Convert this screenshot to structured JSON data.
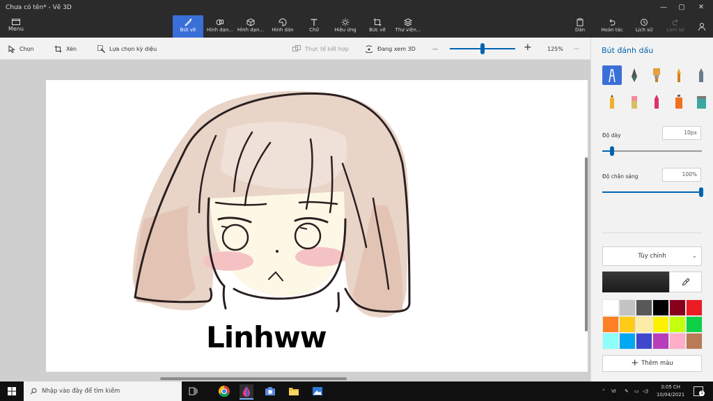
{
  "window": {
    "title": "Chưa có tên* - Vẽ 3D",
    "min": "—",
    "max": "▢",
    "close": "✕"
  },
  "ribbon": {
    "menu": "Menu",
    "tabs": [
      {
        "label": "Bút vẽ"
      },
      {
        "label": "Hình dạn..."
      },
      {
        "label": "Hình dạn..."
      },
      {
        "label": "Hình dán"
      },
      {
        "label": "Chữ"
      },
      {
        "label": "Hiệu ứng"
      },
      {
        "label": "Bức vẽ"
      },
      {
        "label": "Thư viện..."
      }
    ],
    "right": [
      {
        "label": "Dán"
      },
      {
        "label": "Hoàn tác"
      },
      {
        "label": "Lịch sử"
      },
      {
        "label": "Làm lại"
      }
    ]
  },
  "toolbar": {
    "select": "Chọn",
    "crop": "Xén",
    "magic": "Lựa chọn kỳ diệu",
    "mixed_reality": "Thực tế kết hợp",
    "view3d": "Đang xem 3D",
    "zoom_minus": "—",
    "zoom_plus": "+",
    "zoom_value": "125%",
    "zoom_fraction": 0.5,
    "more": "···"
  },
  "canvas": {
    "signature": "Linhww"
  },
  "panel": {
    "title": "Bút đánh dấu",
    "thickness_label": "Độ dày",
    "thickness_value": "10px",
    "thickness_fraction": 0.1,
    "opacity_label": "Độ chắn sáng",
    "opacity_value": "100%",
    "opacity_fraction": 1.0,
    "custom": "Tùy chỉnh",
    "add_color": "Thêm màu",
    "palette": [
      "#ffffff",
      "#c3c3c3",
      "#585858",
      "#000000",
      "#88001b",
      "#ec1c24",
      "#ff7f27",
      "#ffca18",
      "#fdeca6",
      "#fff200",
      "#c4ff0e",
      "#0ed145",
      "#8cfffb",
      "#00a8f3",
      "#3f48cc",
      "#b83dba",
      "#ffaec8",
      "#b97a56"
    ],
    "current_color": "#222222"
  },
  "taskbar": {
    "search_placeholder": "Nhập vào đây để tìm kiếm",
    "lang": "VI",
    "time": "3:05 CH",
    "date": "10/04/2021",
    "notif": "1"
  }
}
